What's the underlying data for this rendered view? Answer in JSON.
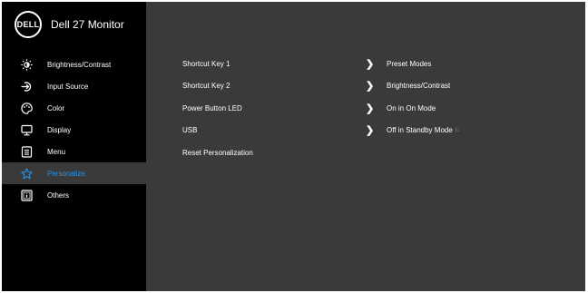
{
  "brand": {
    "logo_text": "DELL",
    "model": "Dell 27 Monitor"
  },
  "menu": [
    {
      "name": "brightness-contrast",
      "label": "Brightness/Contrast",
      "icon": "sun-icon",
      "active": false
    },
    {
      "name": "input-source",
      "label": "Input Source",
      "icon": "input-source-icon",
      "active": false
    },
    {
      "name": "color",
      "label": "Color",
      "icon": "palette-icon",
      "active": false
    },
    {
      "name": "display",
      "label": "Display",
      "icon": "monitor-icon",
      "active": false
    },
    {
      "name": "menu",
      "label": "Menu",
      "icon": "menu-list-icon",
      "active": false
    },
    {
      "name": "personalize",
      "label": "Personalize",
      "icon": "star-icon",
      "active": true
    },
    {
      "name": "others",
      "label": "Others",
      "icon": "info-icon",
      "active": false
    }
  ],
  "settings": [
    {
      "label": "Shortcut Key 1",
      "value": "Preset Modes",
      "has_arrow": true
    },
    {
      "label": "Shortcut Key 2",
      "value": "Brightness/Contrast",
      "has_arrow": true
    },
    {
      "label": "Power Button LED",
      "value": "On in On Mode",
      "has_arrow": true
    },
    {
      "label": "USB",
      "value": "Off in Standby Mode",
      "value_extra": "⚐",
      "has_arrow": true
    },
    {
      "label": "Reset Personalization",
      "value": "",
      "has_arrow": false
    }
  ],
  "colors": {
    "sidebar_bg": "#000000",
    "main_bg": "#3a3a3a",
    "active_text": "#2f8fdb",
    "text": "#ffffff"
  }
}
